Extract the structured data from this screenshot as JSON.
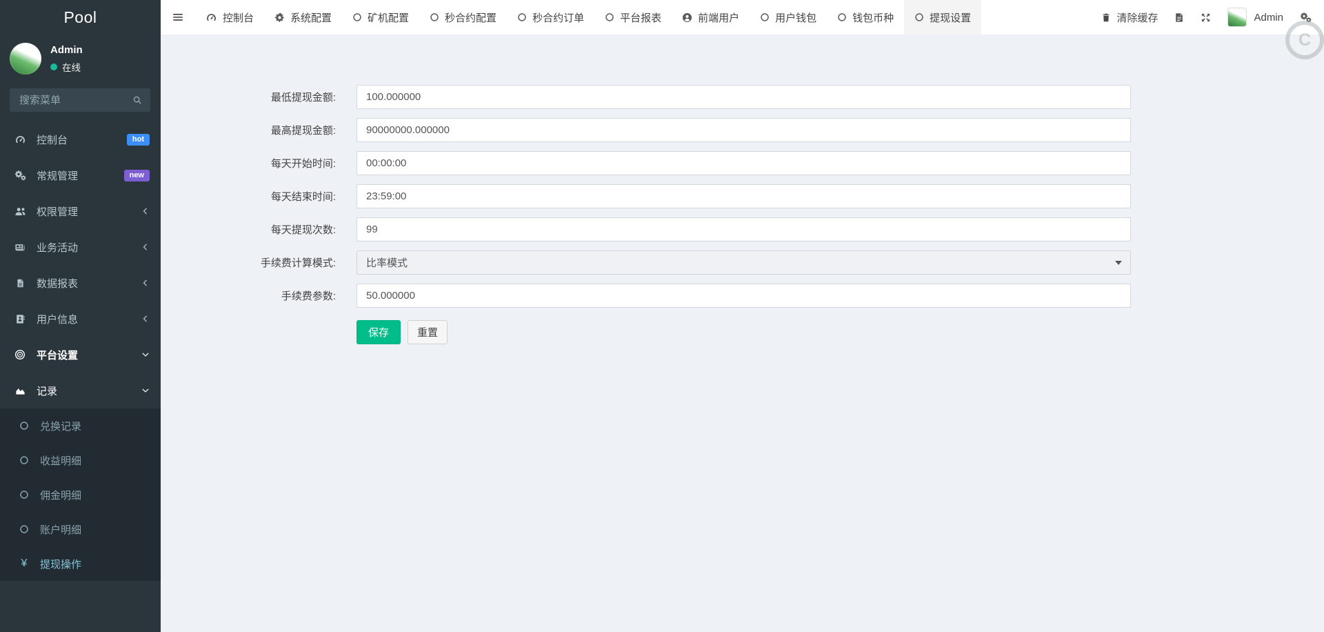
{
  "brand": {
    "logo_text": "Pool"
  },
  "user_panel": {
    "name": "Admin",
    "status": "在线"
  },
  "sidebar": {
    "search_placeholder": "搜索菜单",
    "menu": [
      {
        "name": "dashboard",
        "label": "控制台",
        "icon": "tachometer-icon",
        "badge": {
          "text": "hot",
          "color": "#3d8ef7"
        }
      },
      {
        "name": "general-management",
        "label": "常规管理",
        "icon": "cogs-icon",
        "badge": {
          "text": "new",
          "color": "#7d5fd3"
        }
      },
      {
        "name": "permission-management",
        "label": "权限管理",
        "icon": "users-icon",
        "chevron": "left"
      },
      {
        "name": "business-activity",
        "label": "业务活动",
        "icon": "newspaper-icon",
        "chevron": "left"
      },
      {
        "name": "data-report",
        "label": "数据报表",
        "icon": "file-icon",
        "chevron": "left"
      },
      {
        "name": "user-info",
        "label": "用户信息",
        "icon": "address-book-icon",
        "chevron": "left"
      },
      {
        "name": "platform-settings",
        "label": "平台设置",
        "icon": "bullseye-icon",
        "chevron": "down",
        "active": true
      },
      {
        "name": "records",
        "label": "记录",
        "icon": "area-chart-icon",
        "chevron": "down",
        "open": true
      }
    ],
    "submenu": [
      {
        "name": "exchange-records",
        "label": "兑换记录",
        "icon": "circle-icon"
      },
      {
        "name": "income-detail",
        "label": "收益明细",
        "icon": "circle-icon"
      },
      {
        "name": "commission-detail",
        "label": "佣金明细",
        "icon": "circle-icon"
      },
      {
        "name": "account-detail",
        "label": "账户明细",
        "icon": "circle-icon"
      },
      {
        "name": "withdraw-operation",
        "label": "提现操作",
        "icon": "yen-icon",
        "highlighted": true
      }
    ]
  },
  "navbar": {
    "tabs": [
      {
        "name": "console",
        "label": "控制台",
        "icon": "tachometer-icon"
      },
      {
        "name": "system-config",
        "label": "系统配置",
        "icon": "gear-icon"
      },
      {
        "name": "miner-config",
        "label": "矿机配置",
        "icon": "circle-icon"
      },
      {
        "name": "second-contract-config",
        "label": "秒合约配置",
        "icon": "circle-icon"
      },
      {
        "name": "second-contract-orders",
        "label": "秒合约订单",
        "icon": "circle-icon"
      },
      {
        "name": "platform-report",
        "label": "平台报表",
        "icon": "circle-icon"
      },
      {
        "name": "frontend-users",
        "label": "前端用户",
        "icon": "user-circle-icon"
      },
      {
        "name": "user-wallet",
        "label": "用户钱包",
        "icon": "circle-icon"
      },
      {
        "name": "wallet-currency",
        "label": "钱包币种",
        "icon": "circle-icon"
      },
      {
        "name": "withdraw-settings",
        "label": "提现设置",
        "icon": "circle-icon",
        "active": true
      }
    ],
    "clear_cache_label": "清除缓存",
    "admin_label": "Admin"
  },
  "form": {
    "fields": [
      {
        "name": "min-withdraw-amount",
        "label": "最低提现金额:",
        "value": "100.000000",
        "control": "input"
      },
      {
        "name": "max-withdraw-amount",
        "label": "最高提现金额:",
        "value": "90000000.000000",
        "control": "input"
      },
      {
        "name": "daily-start-time",
        "label": "每天开始时间:",
        "value": "00:00:00",
        "control": "input"
      },
      {
        "name": "daily-end-time",
        "label": "每天结束时间:",
        "value": "23:59:00",
        "control": "input"
      },
      {
        "name": "daily-withdraw-count",
        "label": "每天提现次数:",
        "value": "99",
        "control": "input"
      },
      {
        "name": "fee-calc-mode",
        "label": "手续费计算模式:",
        "value": "比率模式",
        "control": "select"
      },
      {
        "name": "fee-param",
        "label": "手续费参数:",
        "value": "50.000000",
        "control": "input"
      }
    ],
    "save_label": "保存",
    "reset_label": "重置"
  },
  "float_badge": {
    "glyph": "C"
  },
  "colors": {
    "sidebar_bg": "#2b363c",
    "submenu_bg": "#212b31",
    "online_dot": "#18bc9c",
    "badge_hot": "#3d8ef7",
    "badge_new": "#7d5fd3",
    "save_button": "#00bd8a",
    "content_bg": "#eef1f5"
  }
}
